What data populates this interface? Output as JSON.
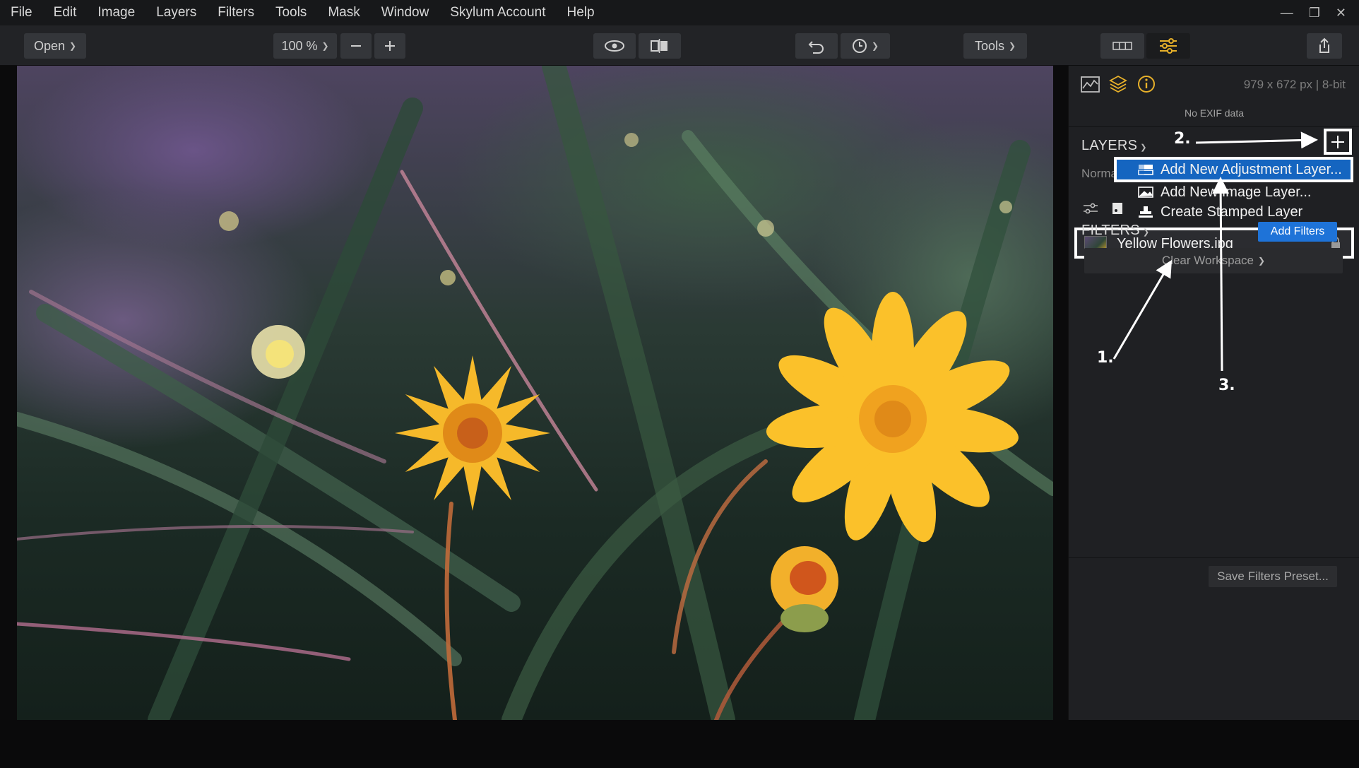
{
  "menu": [
    "File",
    "Edit",
    "Image",
    "Layers",
    "Filters",
    "Tools",
    "Mask",
    "Window",
    "Skylum Account",
    "Help"
  ],
  "toolbar": {
    "open_label": "Open",
    "zoom_label": "100 %",
    "tools_label": "Tools"
  },
  "panel": {
    "image_info": "979 x 672 px  |  8-bit",
    "no_exif": "No EXIF data",
    "layers_title": "LAYERS",
    "blend_mode": "Norma",
    "layer_name": "Yellow Flowers.jpg",
    "filters_title": "FILTERS",
    "add_filters": "Add Filters",
    "clear_workspace": "Clear Workspace",
    "save_preset": "Save Filters Preset..."
  },
  "layer_menu": {
    "items": [
      "Add New Adjustment Layer...",
      "Add New Image Layer...",
      "Create Stamped Layer"
    ],
    "selected_index": 0
  },
  "annotations": [
    "1.",
    "2.",
    "3."
  ],
  "colors": {
    "accent": "#1e73d8",
    "info_icon": "#e8b12a",
    "layers_icon": "#e8b12a",
    "menu_highlight": "#1565c0"
  }
}
